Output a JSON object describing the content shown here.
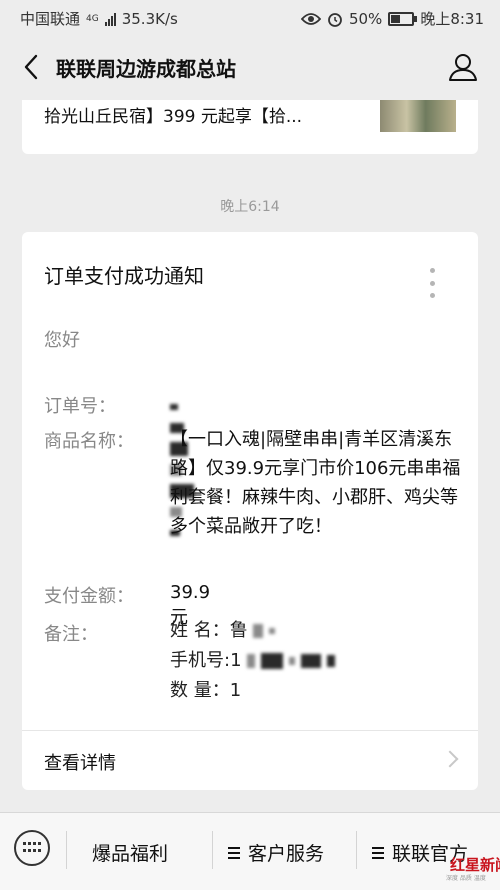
{
  "status_bar": {
    "carrier": "中国联通",
    "network": "4G",
    "speed": "35.3K/s",
    "battery": "50%",
    "battery_level": 0.5,
    "time": "晚上8:31"
  },
  "navbar": {
    "title": "联联周边游成都总站",
    "back_icon": "chevron-left-icon",
    "profile_icon": "person-icon"
  },
  "previous_message": {
    "text": "拾光山丘民宿】399 元起享【拾..."
  },
  "timestamp": "晚上6:14",
  "notification": {
    "title": "订单支付成功通知",
    "greeting": "您好",
    "order_label": "订单号：",
    "product_label": "商品名称：",
    "product_value": "【一口入魂|隔壁串串|青羊区清溪东路】仅39.9元享门市价106元串串福利套餐！麻辣牛肉、小郡肝、鸡尖等多个菜品敞开了吃！",
    "amount_label": "支付金额：",
    "amount_value": "39.9元",
    "remark_label": "备注：",
    "remark_name": "姓  名：鲁",
    "remark_phone": "手机号:1",
    "remark_qty": "数  量：1",
    "detail_label": "查看详情"
  },
  "bottom_menu": {
    "items": [
      "爆品福利",
      "客户服务",
      "联联官方"
    ]
  },
  "watermark": {
    "text": "红星新闻",
    "sub": "深度 品质 温度"
  }
}
